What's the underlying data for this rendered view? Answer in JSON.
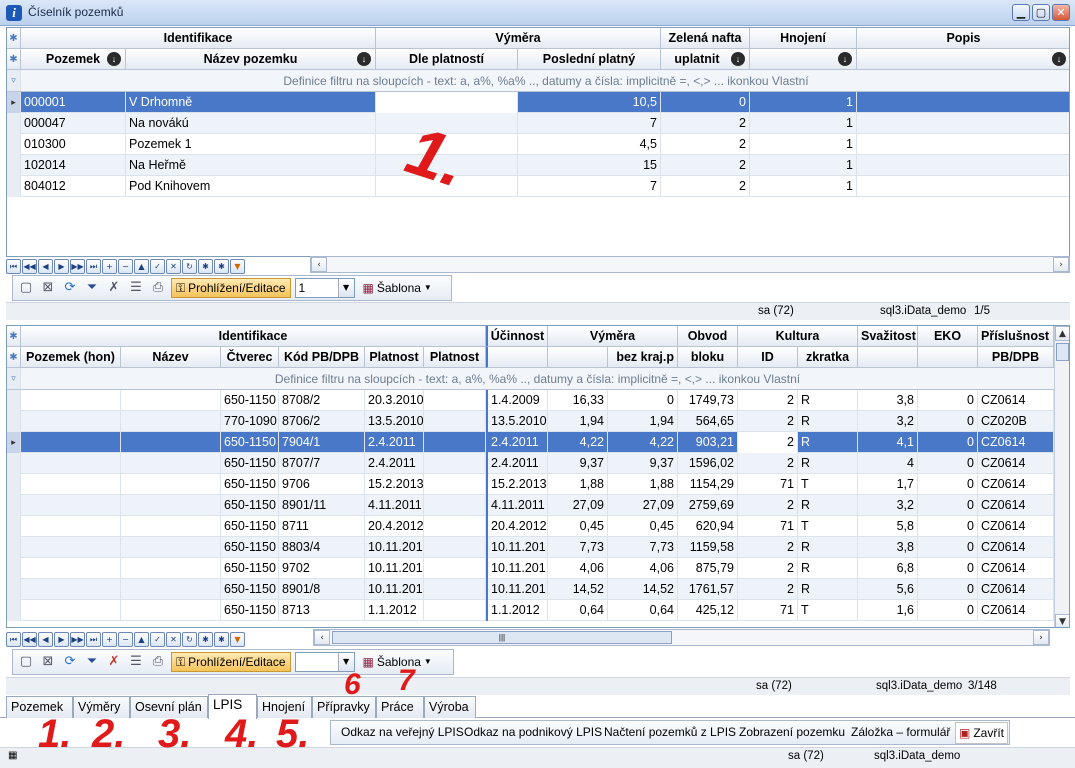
{
  "window": {
    "title": "Číselník pozemků",
    "min": "▁",
    "max": "▢",
    "close": "✕"
  },
  "grid1": {
    "group_headers": [
      "Identifikace",
      "Výměra",
      "Zelená nafta",
      "Hnojení",
      "Popis"
    ],
    "columns": [
      "Pozemek",
      "Název pozemku",
      "Dle platností",
      "Poslední platný",
      "uplatnit",
      "",
      ""
    ],
    "filter_hint": "Definice filtru na sloupcích - text: a, a%, %a% .., datumy a čísla: implicitně =, <,> ... ikonkou Vlastní",
    "rows": [
      [
        "000001",
        "V Drhomně",
        "",
        "10,5",
        "0",
        "1",
        ""
      ],
      [
        "000047",
        "Na novákú",
        "",
        "7",
        "2",
        "1",
        ""
      ],
      [
        "010300",
        "Pozemek 1",
        "",
        "4,5",
        "2",
        "1",
        ""
      ],
      [
        "102014",
        "Na Heřmě",
        "",
        "15",
        "2",
        "1",
        ""
      ],
      [
        "804012",
        "Pod Knihovem",
        "",
        "7",
        "2",
        "1",
        ""
      ]
    ]
  },
  "toolbar1": {
    "mode": "Prohlížení/Editace",
    "combo": "1",
    "template": "Šablona"
  },
  "status1": {
    "user": "sa (72)",
    "db": "sql3.iData_demo",
    "count": "1/5"
  },
  "grid2": {
    "group_headers": [
      "Identifikace",
      "Účinnost",
      "Výměra",
      "Obvod",
      "Kultura",
      "Svažitost",
      "EKO",
      "Příslušnost"
    ],
    "columns": [
      "Pozemek (hon)",
      "Název",
      "Čtverec",
      "Kód PB/DPB",
      "Platnost",
      "Platnost",
      "",
      "",
      "bez kraj.p",
      "bloku",
      "ID",
      "zkratka",
      "",
      "",
      "PB/DPB"
    ],
    "filter_hint": "Definice filtru na sloupcích - text: a, a%, %a% .., datumy a čísla: implicitně =, <,> ... ikonkou Vlastní",
    "rows": [
      [
        "",
        "",
        "650-1150",
        "8708/2",
        "20.3.2010",
        "",
        "1.4.2009",
        "16,33",
        "0",
        "1749,73",
        "2",
        "R",
        "3,8",
        "0",
        "CZ0614"
      ],
      [
        "",
        "",
        "770-1090",
        "8706/2",
        "13.5.2010",
        "",
        "13.5.2010",
        "1,94",
        "1,94",
        "564,65",
        "2",
        "R",
        "3,2",
        "0",
        "CZ020B"
      ],
      [
        "",
        "",
        "650-1150",
        "7904/1",
        "2.4.2011",
        "",
        "2.4.2011",
        "4,22",
        "4,22",
        "903,21",
        "2",
        "R",
        "4,1",
        "0",
        "CZ0614"
      ],
      [
        "",
        "",
        "650-1150",
        "8707/7",
        "2.4.2011",
        "",
        "2.4.2011",
        "9,37",
        "9,37",
        "1596,02",
        "2",
        "R",
        "4",
        "0",
        "CZ0614"
      ],
      [
        "",
        "",
        "650-1150",
        "9706",
        "15.2.2013",
        "",
        "15.2.2013",
        "1,88",
        "1,88",
        "1154,29",
        "71",
        "T",
        "1,7",
        "0",
        "CZ0614"
      ],
      [
        "",
        "",
        "650-1150",
        "8901/11",
        "4.11.2011",
        "",
        "4.11.2011",
        "27,09",
        "27,09",
        "2759,69",
        "2",
        "R",
        "3,2",
        "0",
        "CZ0614"
      ],
      [
        "",
        "",
        "650-1150",
        "8711",
        "20.4.2012",
        "",
        "20.4.2012",
        "0,45",
        "0,45",
        "620,94",
        "71",
        "T",
        "5,8",
        "0",
        "CZ0614"
      ],
      [
        "",
        "",
        "650-1150",
        "8803/4",
        "10.11.201",
        "",
        "10.11.201",
        "7,73",
        "7,73",
        "1159,58",
        "2",
        "R",
        "3,8",
        "0",
        "CZ0614"
      ],
      [
        "",
        "",
        "650-1150",
        "9702",
        "10.11.201",
        "",
        "10.11.201",
        "4,06",
        "4,06",
        "875,79",
        "2",
        "R",
        "6,8",
        "0",
        "CZ0614"
      ],
      [
        "",
        "",
        "650-1150",
        "8901/8",
        "10.11.201",
        "",
        "10.11.201",
        "14,52",
        "14,52",
        "1761,57",
        "2",
        "R",
        "5,6",
        "0",
        "CZ0614"
      ],
      [
        "",
        "",
        "650-1150",
        "8713",
        "1.1.2012",
        "",
        "1.1.2012",
        "0,64",
        "0,64",
        "425,12",
        "71",
        "T",
        "1,6",
        "0",
        "CZ0614"
      ]
    ]
  },
  "toolbar2": {
    "mode": "Prohlížení/Editace",
    "combo": "",
    "template": "Šablona"
  },
  "status2": {
    "user": "sa (72)",
    "db": "sql3.iData_demo",
    "count": "3/148"
  },
  "tabs": [
    "Pozemek",
    "Výměry",
    "Osevní plán",
    "LPIS",
    "Hnojení",
    "Přípravky",
    "Práce",
    "Výroba"
  ],
  "actions": [
    "Odkaz na veřejný LPIS",
    "Odkaz na podnikový LPIS",
    "Načtení pozemků z LPIS",
    "Zobrazení pozemku",
    "Záložka – formulář",
    "Zavřít"
  ],
  "status_bottom": {
    "user": "sa (72)",
    "db": "sql3.iData_demo"
  },
  "annotations": [
    "1.",
    "1.",
    "2.",
    "3.",
    "4.",
    "5.",
    "6",
    "7"
  ]
}
